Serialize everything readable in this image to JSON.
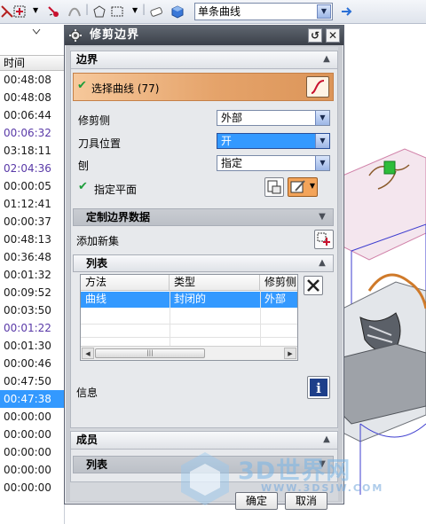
{
  "toolbar": {
    "curve_rule": "单条曲线"
  },
  "time_list": {
    "header": "时间",
    "rows": [
      "00:48:08",
      "00:48:08",
      "00:06:44",
      "00:06:32",
      "03:18:11",
      "02:04:36",
      "00:00:05",
      "01:12:41",
      "00:00:37",
      "00:48:13",
      "00:36:48",
      "00:01:32",
      "00:09:52",
      "00:03:50",
      "00:01:22",
      "00:01:30",
      "00:00:46",
      "00:47:50",
      "00:47:38",
      "00:00:00",
      "00:00:00",
      "00:00:00",
      "00:00:00",
      "00:00:00"
    ]
  },
  "dialog": {
    "title": "修剪边界",
    "boundary": {
      "header": "边界",
      "select_curve": "选择曲线 (77)",
      "trim_side_label": "修剪侧",
      "trim_side_value": "外部",
      "tool_pos_label": "刀具位置",
      "tool_pos_value": "开",
      "plane_label": "刨",
      "plane_value": "指定",
      "specify_plane": "指定平面",
      "custom_data": "定制边界数据",
      "add_new_set": "添加新集"
    },
    "list": {
      "header": "列表",
      "columns": [
        "方法",
        "类型",
        "修剪侧"
      ],
      "rows": [
        [
          "曲线",
          "封闭的",
          "外部"
        ]
      ],
      "info": "信息"
    },
    "members": {
      "header": "成员",
      "list_header": "列表"
    },
    "ok": "确定",
    "cancel": "取消"
  },
  "watermark": {
    "text": "3D世界网",
    "url": "WWW.3DSJW.COM"
  },
  "colors": {
    "selection": "#3399ff",
    "accent_orange": "#e5a36a",
    "check_green": "#1c9d3a"
  }
}
